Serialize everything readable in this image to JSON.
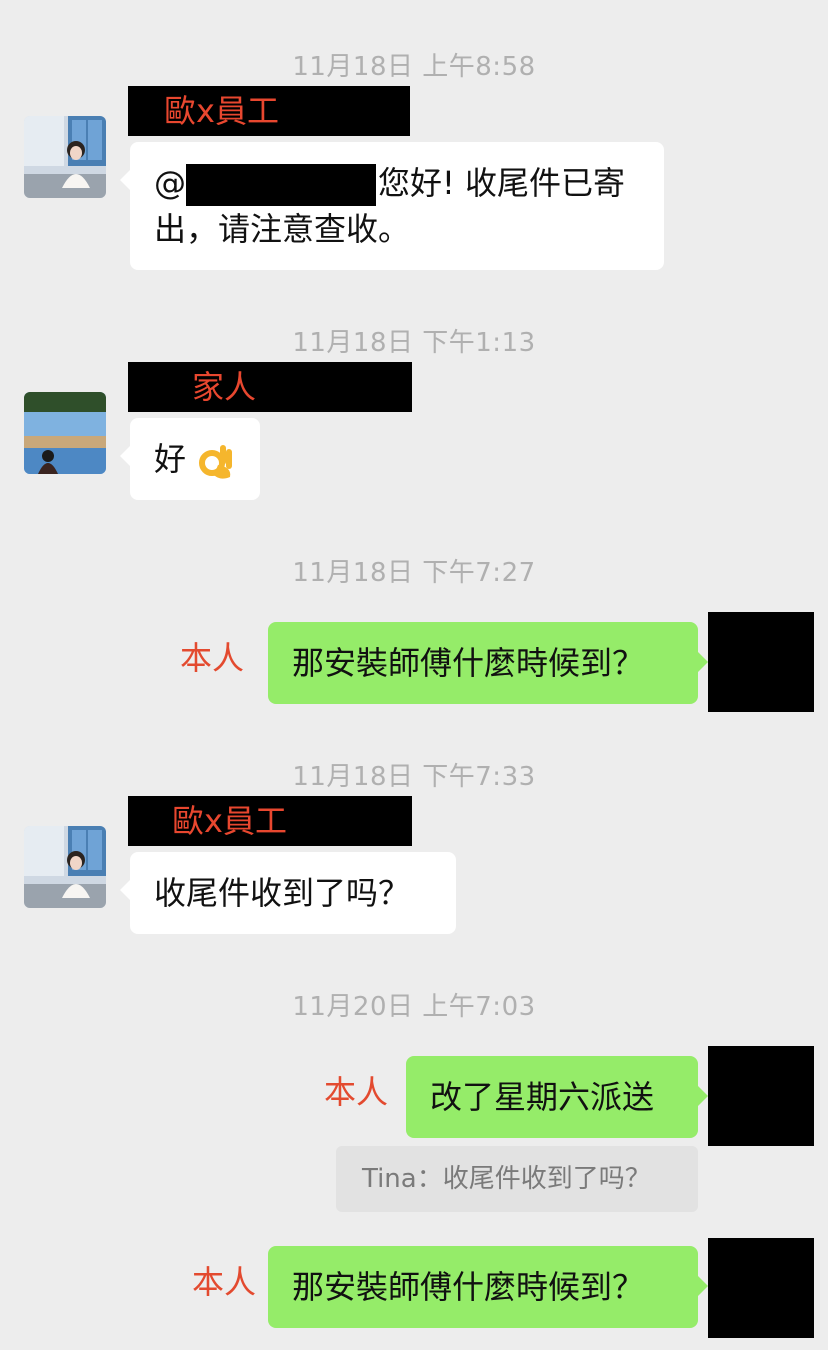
{
  "messages": [
    {
      "time": "11月18日 上午8:58",
      "sender": "歐x員工",
      "side": "left",
      "avatar_icon": "woman-portrait-avatar",
      "mention_prefix": "@",
      "text_line1": "您好! 收尾件已寄",
      "text_line2": "出，请注意查收。"
    },
    {
      "time": "11月18日 下午1:13",
      "sender": "家人",
      "side": "left",
      "avatar_icon": "lake-landscape-avatar",
      "text": "好",
      "emoji": "ok-hand-emoji"
    },
    {
      "time": "11月18日 下午7:27",
      "sender": "本人",
      "side": "right",
      "text": "那安裝師傅什麼時候到？"
    },
    {
      "time": "11月18日 下午7:33",
      "sender": "歐x員工",
      "side": "left",
      "avatar_icon": "woman-portrait-avatar",
      "text": "收尾件收到了吗？"
    },
    {
      "time": "11月20日 上午7:03",
      "sender": "本人",
      "side": "right",
      "text": "改了星期六派送",
      "quote": "Tina：收尾件收到了吗？"
    },
    {
      "sender": "本人",
      "side": "right",
      "text": "那安裝師傅什麼時候到？"
    }
  ],
  "colors": {
    "background": "#ededed",
    "timestamp": "#b0b0b0",
    "sender_name": "#e8472f",
    "incoming_bubble": "#ffffff",
    "outgoing_bubble": "#95ec69",
    "quote_bg": "#e2e2e2"
  }
}
